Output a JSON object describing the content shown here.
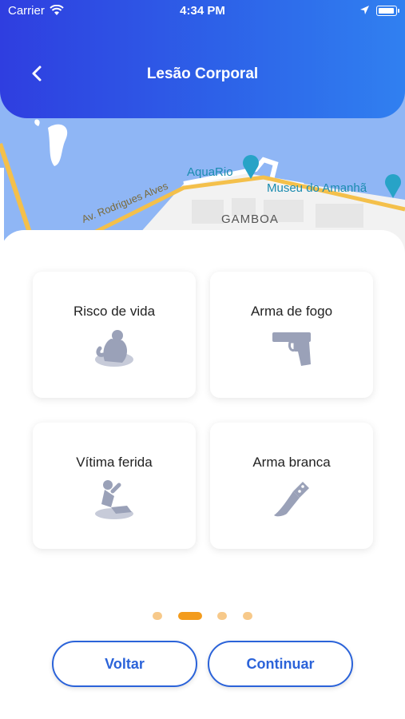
{
  "status_bar": {
    "carrier": "Carrier",
    "time": "4:34 PM"
  },
  "header": {
    "title": "Lesão Corporal"
  },
  "map": {
    "labels": {
      "aquario": "AquaRio",
      "museu": "Museu do Amanhã",
      "street": "Av. Rodrigues Alves",
      "district": "GAMBOA"
    }
  },
  "options": [
    {
      "label": "Risco de vida",
      "icon": "person-at-risk-icon"
    },
    {
      "label": "Arma de fogo",
      "icon": "pistol-icon"
    },
    {
      "label": "Vítima ferida",
      "icon": "injured-person-icon"
    },
    {
      "label": "Arma branca",
      "icon": "knife-icon"
    }
  ],
  "pagination": {
    "pages": 4,
    "current": 2
  },
  "buttons": {
    "back": "Voltar",
    "continue": "Continuar"
  },
  "colors": {
    "primary": "#2b63d9",
    "accent": "#f39c1d",
    "icon_gray": "#9aa1b8"
  }
}
